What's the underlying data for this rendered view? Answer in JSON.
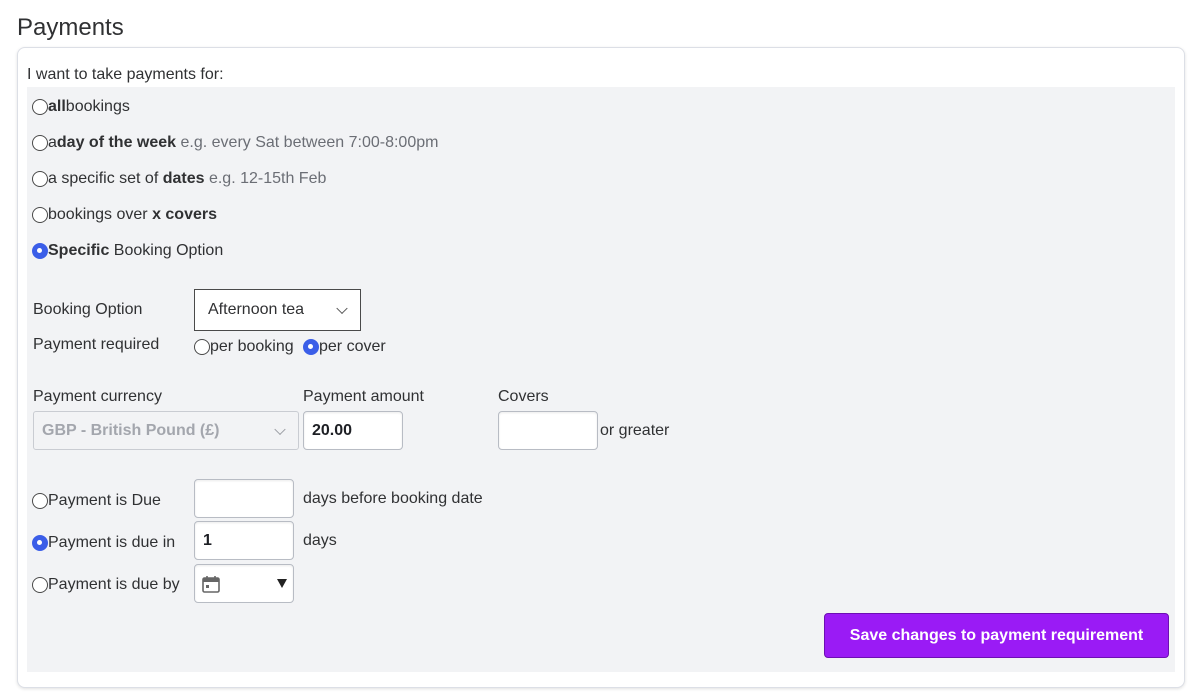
{
  "page": {
    "title": "Payments"
  },
  "form": {
    "intro": "I want to take payments for:",
    "options": [
      {
        "bold_pre": "all",
        "text": " bookings",
        "bold_post": "",
        "hint": "",
        "selected": false
      },
      {
        "pre": "a ",
        "bold": "day of the week",
        "hint": " e.g. every Sat between 7:00-8:00pm",
        "selected": false
      },
      {
        "pre": "a specific set of ",
        "bold": "dates",
        "hint": " e.g. 12-15th Feb",
        "selected": false
      },
      {
        "pre": "bookings over ",
        "bold": "x covers",
        "hint": "",
        "selected": false
      },
      {
        "bold": "Specific",
        "post": " Booking Option",
        "selected": true
      }
    ],
    "booking_option": {
      "label": "Booking Option",
      "value": "Afternoon tea"
    },
    "payment_required": {
      "label": "Payment required",
      "per_booking": "per booking",
      "per_cover": "per cover",
      "selected": "per cover"
    },
    "currency": {
      "label": "Payment currency",
      "value": "GBP - British Pound (£)"
    },
    "amount": {
      "label": "Payment amount",
      "value": "20.00"
    },
    "covers": {
      "label": "Covers",
      "value": "",
      "suffix": "or greater"
    },
    "due": {
      "option1": {
        "label": "Payment is Due",
        "value": "",
        "suffix": "days before booking date",
        "selected": false
      },
      "option2": {
        "label": "Payment is due in",
        "value": "1",
        "suffix": "days",
        "selected": true
      },
      "option3": {
        "label": "Payment is due by",
        "selected": false,
        "icon": "calendar-icon"
      }
    },
    "save_label": "Save changes to payment requirement"
  },
  "colors": {
    "accent": "#3b5ee8",
    "button": "#9a1bf5",
    "panel": "#f2f3f5"
  }
}
